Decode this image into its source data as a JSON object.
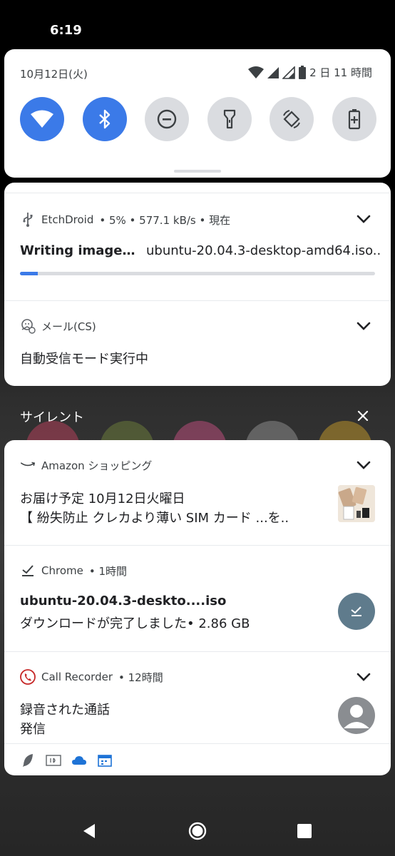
{
  "status_bar": {
    "time": "6:19"
  },
  "quick_settings": {
    "date": "10月12日(火)",
    "battery_text": "2 日 11 時間",
    "tiles": [
      {
        "name": "wifi",
        "on": true
      },
      {
        "name": "bluetooth",
        "on": true
      },
      {
        "name": "do-not-disturb",
        "on": false
      },
      {
        "name": "flashlight",
        "on": false
      },
      {
        "name": "auto-rotate",
        "on": false
      },
      {
        "name": "battery-saver",
        "on": false
      }
    ]
  },
  "notifications_alerting": [
    {
      "app": "EtchDroid",
      "meta": "• 5% • 577.1 kB/s • 現在",
      "title": "Writing image…",
      "subtitle": "ubuntu-20.04.3-desktop-amd64.iso..",
      "progress": 0.05,
      "icon": "usb-icon"
    },
    {
      "app": "メール(CS)",
      "meta": "",
      "body": "自動受信モード実行中",
      "icon": "mail-sync-icon"
    }
  ],
  "silent_section": {
    "label": "サイレント"
  },
  "notifications_silent": [
    {
      "app": "Amazon ショッピング",
      "meta": "",
      "title": "お届け予定 10月12日火曜日",
      "body": "【 紛失防止 クレカより薄い SIM カード ...を..",
      "icon": "amazon-icon"
    },
    {
      "app": "Chrome",
      "meta": "• 1時間",
      "title": "ubuntu-20.04.3-deskto....iso",
      "body": "ダウンロードが完了しました• 2.86 GB",
      "icon": "download-icon"
    },
    {
      "app": "Call Recorder",
      "meta": "• 12時間",
      "title": "録音された通話",
      "body": "発信",
      "icon": "phone-icon"
    }
  ],
  "colors": {
    "accent": "#3b7ae8",
    "tile_off": "#dadce0",
    "chrome_badge": "#5f7b8c"
  }
}
